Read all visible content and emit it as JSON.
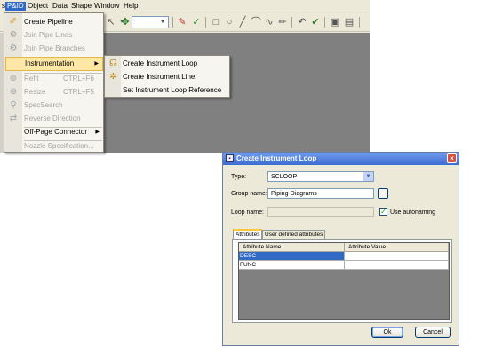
{
  "menubar": {
    "items": [
      "s",
      "P&ID",
      "Object",
      "Data",
      "Shape",
      "Window",
      "Help"
    ]
  },
  "toolbar": {
    "icons": [
      "grip-icon",
      "pointer-icon",
      "combo-arrow-icon",
      "crosshair-icon",
      "tag-icon",
      "connect-icon",
      "rectangle-icon",
      "ellipse-icon",
      "line-icon",
      "arc-icon",
      "curve-icon",
      "pencil-icon",
      "undo-icon",
      "checkmark-icon",
      "image-icon",
      "open-icon"
    ]
  },
  "pid_menu": {
    "items": [
      {
        "label": "Create Pipeline",
        "icon": "pipeline-icon",
        "enabled": true
      },
      {
        "label": "Join Pipe Lines",
        "icon": "join-lines-icon",
        "enabled": false
      },
      {
        "label": "Join Pipe Branches",
        "icon": "join-branches-icon",
        "enabled": false
      },
      {
        "label": "Instrumentation",
        "icon": "instrumentation-icon",
        "enabled": true,
        "submenu": true,
        "highlighted": true
      },
      {
        "label": "Refit",
        "icon": "refit-icon",
        "shortcut": "CTRL+F6",
        "enabled": false
      },
      {
        "label": "Resize",
        "icon": "resize-icon",
        "shortcut": "CTRL+F5",
        "enabled": false
      },
      {
        "label": "SpecSearch",
        "icon": "spec-search-icon",
        "enabled": false
      },
      {
        "label": "Reverse Direction",
        "icon": "reverse-direction-icon",
        "enabled": false
      },
      {
        "label": "Off-Page Connector",
        "icon": "",
        "enabled": true,
        "submenu": true
      },
      {
        "label": "Nozzle Specification...",
        "icon": "",
        "enabled": false
      }
    ]
  },
  "instrumentation_submenu": {
    "items": [
      {
        "label": "Create Instrument Loop",
        "icon": "instrument-loop-icon"
      },
      {
        "label": "Create Instrument Line",
        "icon": "instrument-line-icon"
      },
      {
        "label": "Set Instrument Loop Reference",
        "icon": ""
      }
    ]
  },
  "dialog": {
    "title": "Create Instrument Loop",
    "type_label": "Type:",
    "type_value": "SCLOOP",
    "group_label": "Group name:",
    "group_value": "Piping-Diagrams",
    "browse_label": "...",
    "loop_label": "Loop name:",
    "loop_value": "",
    "autonaming_label": "Use autonaming",
    "autonaming_checked": true,
    "tabs": [
      {
        "label": "Attributes",
        "active": true
      },
      {
        "label": "User defined attributes",
        "active": false
      }
    ],
    "grid": {
      "columns": [
        "Attribute Name",
        "Attribute Value"
      ],
      "rows": [
        {
          "name": "DESC",
          "value": "",
          "selected": true
        },
        {
          "name": "FUNC",
          "value": "",
          "selected": false
        }
      ]
    },
    "ok_label": "Ok",
    "cancel_label": "Cancel"
  },
  "colors": {
    "selection": "#316ac5",
    "menu_highlight": "#ffe8a6",
    "titlebar": "#3c6bd3",
    "canvas": "#808080"
  }
}
